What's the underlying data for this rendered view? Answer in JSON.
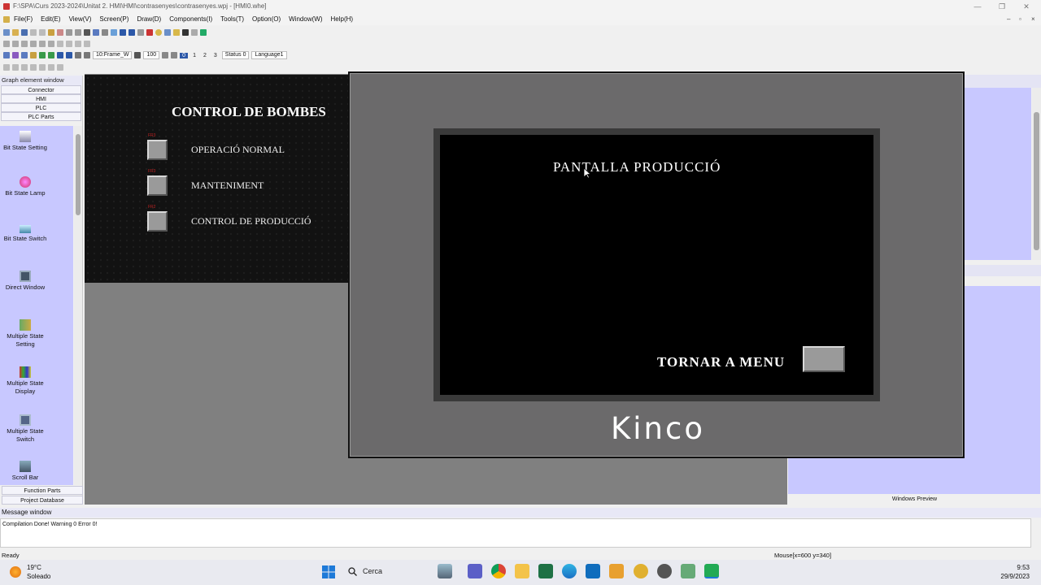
{
  "window": {
    "title": "F:\\SPA\\Curs 2023-2024\\Unitat 2. HMI\\HMI\\contrasenyes\\contrasenyes.wpj - [HMI0.whe]",
    "controls": [
      "—",
      "❐",
      "✕"
    ],
    "mdi_controls": [
      "–",
      "▫",
      "×"
    ]
  },
  "menu": [
    "File(F)",
    "Edit(E)",
    "View(V)",
    "Screen(P)",
    "Draw(D)",
    "Components(I)",
    "Tools(T)",
    "Option(O)",
    "Window(W)",
    "Help(H)"
  ],
  "toolbar": {
    "frame_select": "10:Frame_W",
    "zoom": "100",
    "state_buttons": [
      "0",
      "1",
      "2",
      "3"
    ],
    "status_select": "Status 0",
    "language_select": "Language1"
  },
  "left_panel": {
    "title": "Graph element window",
    "categories": [
      "Connector",
      "HMI",
      "PLC",
      "PLC Parts"
    ],
    "parts": [
      "Bit State Setting",
      "Bit State Lamp",
      "Bit State Switch",
      "Direct Window",
      "Multiple State Setting",
      "Multiple State Display",
      "Multiple State Switch",
      "Scroll Bar"
    ],
    "bottom_tabs": [
      "Function Parts",
      "Project Database"
    ]
  },
  "hmi0": {
    "title": "CONTROL DE BOMBES",
    "items": [
      {
        "tag": "FR3",
        "label": "OPERACIÓ NORMAL"
      },
      {
        "tag": "FR3",
        "label": "MANTENIMENT"
      },
      {
        "tag": "FR2",
        "label": "CONTROL DE PRODUCCIÓ"
      }
    ]
  },
  "hmi_panel": {
    "screen_title": "PANTALLA PRODUCCIÓ",
    "back_label": "TORNAR A MENU",
    "brand": "Kinco"
  },
  "right_panel": {
    "preview_label": "Windows Preview"
  },
  "message_window": {
    "title": "Message window",
    "text": "Compilation Done! Warning 0 Error 0!"
  },
  "status": {
    "left": "Ready",
    "mouse": "Mouse[x=600  y=340]"
  },
  "taskbar": {
    "weather_temp": "19°C",
    "weather_desc": "Soleado",
    "search": "Cerca",
    "time": "9:53",
    "date": "29/9/2023"
  },
  "colors": {
    "parts_bg": "#c8c8ff",
    "workspace": "#808080",
    "panel_frame": "#6b6a6b"
  }
}
